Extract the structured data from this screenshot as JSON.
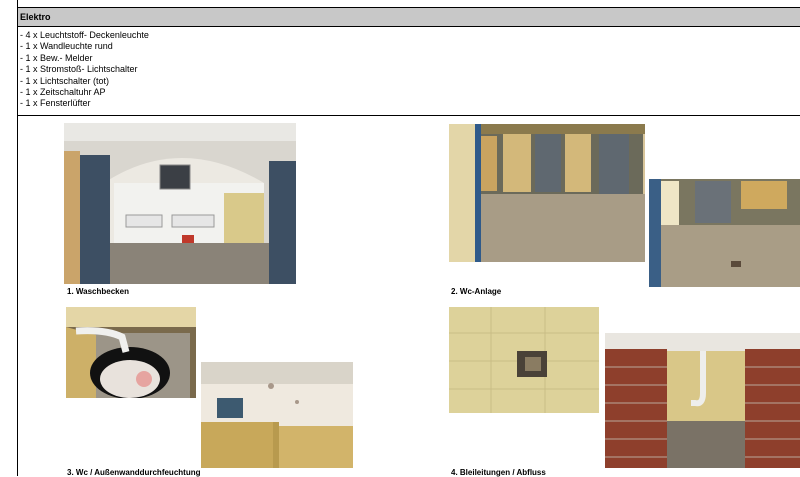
{
  "section": {
    "title": "Elektro"
  },
  "items": [
    "- 4 x Leuchtstoff- Deckenleuchte",
    "- 1 x Wandleuchte rund",
    "- 1 x Bew.- Melder",
    "- 1 x Stromstoß- Lichtschalter",
    "- 1 x Lichtschalter (tot)",
    "- 1 x Zeitschaltuhr AP",
    "- 1 x Fensterlüfter"
  ],
  "captions": {
    "c1": "1. Waschbecken",
    "c2": "2. Wc-Anlage",
    "c3": "3. Wc / Außenwanddurchfeuchtung",
    "c4": "4. Bleileitungen / Abfluss"
  }
}
